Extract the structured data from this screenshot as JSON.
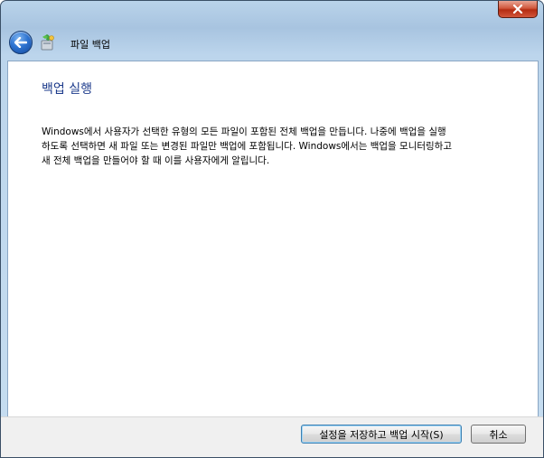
{
  "header": {
    "title": "파일 백업"
  },
  "content": {
    "title": "백업 실행",
    "description": "Windows에서 사용자가 선택한 유형의 모든 파일이 포함된 전체 백업을 만듭니다. 나중에 백업을 실행\n하도록 선택하면 새 파일 또는 변경된 파일만 백업에 포함됩니다. Windows에서는 백업을 모니터링하고\n새 전체 백업을 만들어야 할 때 이를 사용자에게 알립니다."
  },
  "footer": {
    "save_start_label": "설정을 저장하고 백업 시작(S)",
    "cancel_label": "취소"
  },
  "icons": {
    "close": "close-icon",
    "back": "back-arrow-icon",
    "app": "backup-app-icon"
  },
  "colors": {
    "title_blue": "#1e3c8c",
    "close_red": "#c8442a",
    "back_blue": "#2e74d1"
  }
}
